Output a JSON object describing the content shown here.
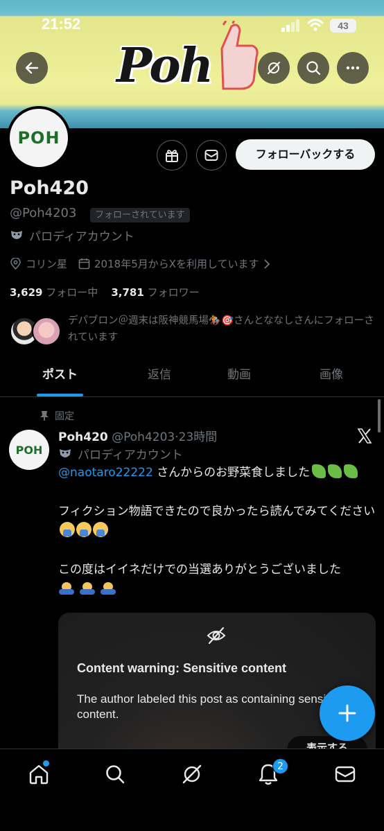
{
  "status_bar": {
    "time": "21:52",
    "battery": "43"
  },
  "banner": {
    "logo_text": "Poh"
  },
  "profile": {
    "avatar_text": "POH",
    "follow_back_label": "フォローバックする",
    "display_name": "Poh420",
    "handle": "@Poh4203",
    "follows_you_badge": "フォローされています",
    "parody_label": "パロディアカウント",
    "location": "コリン星",
    "joined": "2018年5月からXを利用しています",
    "following_count": "3,629",
    "following_label": "フォロー中",
    "followers_count": "3,781",
    "followers_label": "フォロワー",
    "followers_you_know": "デパブロン＠週末は阪神競馬場🏇🎯さんとななしさんにフォローされています"
  },
  "tabs": [
    "ポスト",
    "返信",
    "動画",
    "画像"
  ],
  "active_tab": "ポスト",
  "post": {
    "pinned_label": "固定",
    "author_name": "Poh420",
    "author_handle": "@Poh4203",
    "time_ago": "23時間",
    "parody_label": "パロディアカウント",
    "mention": "@naotaro22222",
    "line1_rest": " さんからのお野菜食しました",
    "paragraph2": "フィクション物語できたので良かったら読んでみてください",
    "paragraph3": "この度はイイネだけでの当選ありがとうございました",
    "content_warning_title": "Content warning: Sensitive content",
    "content_warning_desc": "The author labeled this post as containing sensitive content.",
    "show_label": "表示する"
  },
  "bottom_nav": {
    "notification_count": "2"
  },
  "colors": {
    "accent": "#1d9bf0",
    "background": "#000000",
    "secondary_text": "#71767b"
  },
  "icons": [
    "back-arrow-icon",
    "grok-icon",
    "search-icon",
    "more-icon",
    "gift-icon",
    "mail-icon",
    "location-icon",
    "calendar-icon",
    "pin-icon",
    "x-logo-icon",
    "eye-off-icon",
    "plus-icon",
    "home-icon",
    "bell-icon"
  ]
}
